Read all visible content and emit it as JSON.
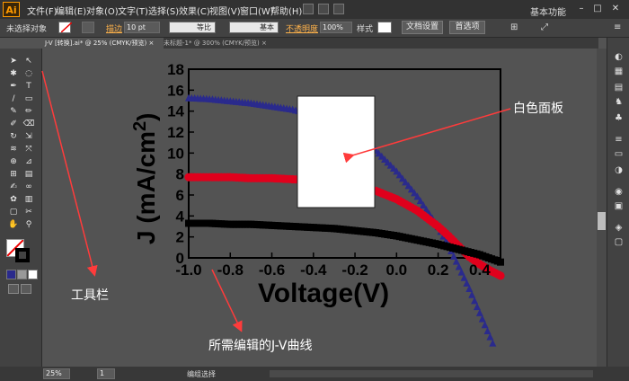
{
  "app": {
    "logo": "Ai"
  },
  "menubar": {
    "items": [
      "文件(F)",
      "编辑(E)",
      "对象(O)",
      "文字(T)",
      "选择(S)",
      "效果(C)",
      "视图(V)",
      "窗口(W)",
      "帮助(H)"
    ],
    "workspace": "基本功能",
    "window_buttons": [
      "–",
      "□",
      "✕"
    ]
  },
  "controlbar": {
    "selection": "未选择对象",
    "stroke_label": "描边",
    "stroke_value": "10 pt",
    "profile_label": "等比",
    "brush_label": "基本",
    "opacity_label": "不透明度",
    "opacity_value": "100%",
    "style_label": "样式",
    "doc_settings": "文档设置",
    "preferences": "首选项"
  },
  "tabs": [
    {
      "label": "J-V [转换].ai* @ 25% (CMYK/预览)",
      "close": "×"
    },
    {
      "label": "未标题-1* @ 300% (CMYK/预览)",
      "close": "×"
    }
  ],
  "statusbar": {
    "zoom": "25%",
    "page": "1",
    "status": "编组选择"
  },
  "annotations": {
    "panel": "白色面板",
    "toolbar": "工具栏",
    "curve": "所需编辑的J-V曲线"
  },
  "colors": {
    "annotation_arrow": "#ff3b3b",
    "series_blue": "#2a2a8c",
    "series_red": "#e0001c",
    "series_black": "#000000"
  },
  "icons": {
    "tools": [
      "selection-tool-icon",
      "direct-selection-tool-icon",
      "magic-wand-icon",
      "lasso-icon",
      "pen-tool-icon",
      "type-tool-icon",
      "line-tool-icon",
      "rectangle-tool-icon",
      "paintbrush-icon",
      "pencil-icon",
      "blob-brush-icon",
      "eraser-icon",
      "rotate-icon",
      "scale-icon",
      "width-tool-icon",
      "free-transform-icon",
      "shape-builder-icon",
      "perspective-icon",
      "mesh-icon",
      "gradient-icon",
      "eyedropper-icon",
      "blend-icon",
      "symbol-sprayer-icon",
      "column-graph-icon",
      "artboard-icon",
      "slice-icon",
      "hand-icon",
      "zoom-icon"
    ]
  },
  "chart_data": {
    "type": "line",
    "xlabel": "Voltage(V)",
    "ylabel": "J (mA/cm",
    "ylabel_superscript": "2",
    "ylabel_close": ")",
    "xlim": [
      -1.0,
      0.5
    ],
    "ylim": [
      0,
      18
    ],
    "x_ticks": [
      "-1.0",
      "-0.8",
      "-0.6",
      "-0.4",
      "-0.2",
      "0.0",
      "0.2",
      "0.4"
    ],
    "x_tick_values": [
      -1.0,
      -0.8,
      -0.6,
      -0.4,
      -0.2,
      0.0,
      0.2,
      0.4
    ],
    "y_ticks": [
      "0",
      "2",
      "4",
      "6",
      "8",
      "10",
      "12",
      "14",
      "16",
      "18"
    ],
    "y_tick_values": [
      0,
      2,
      4,
      6,
      8,
      10,
      12,
      14,
      16,
      18
    ],
    "series": [
      {
        "color": "#2a2a8c",
        "marker": "triangle",
        "x": [
          -1.0,
          -0.9,
          -0.8,
          -0.7,
          -0.6,
          -0.5,
          -0.4,
          -0.3,
          -0.2,
          -0.1,
          0.0,
          0.1,
          0.2,
          0.25,
          0.3,
          0.35,
          0.4,
          0.45,
          0.5
        ],
        "y": [
          15.2,
          15.1,
          14.9,
          14.7,
          14.4,
          14.1,
          13.6,
          12.8,
          11.7,
          10.2,
          8.2,
          5.8,
          2.9,
          1.1,
          -0.9,
          -3.0,
          -5.3,
          -7.6,
          -10.0
        ]
      },
      {
        "color": "#e0001c",
        "marker": "circle",
        "x": [
          -1.0,
          -0.9,
          -0.8,
          -0.7,
          -0.6,
          -0.5,
          -0.4,
          -0.3,
          -0.2,
          -0.1,
          0.0,
          0.1,
          0.2,
          0.25,
          0.3,
          0.35,
          0.4,
          0.45,
          0.5
        ],
        "y": [
          7.7,
          7.7,
          7.7,
          7.6,
          7.6,
          7.5,
          7.4,
          7.2,
          6.9,
          6.4,
          5.6,
          4.5,
          3.0,
          2.1,
          1.1,
          0.1,
          -0.6,
          -1.2,
          -1.7
        ]
      },
      {
        "color": "#000000",
        "marker": "square",
        "x": [
          -1.0,
          -0.9,
          -0.8,
          -0.7,
          -0.6,
          -0.5,
          -0.4,
          -0.3,
          -0.2,
          -0.1,
          0.0,
          0.1,
          0.2,
          0.3,
          0.4,
          0.5
        ],
        "y": [
          3.3,
          3.3,
          3.2,
          3.2,
          3.1,
          3.0,
          2.9,
          2.8,
          2.6,
          2.4,
          2.1,
          1.7,
          1.3,
          0.8,
          0.3,
          -0.4
        ]
      }
    ]
  }
}
